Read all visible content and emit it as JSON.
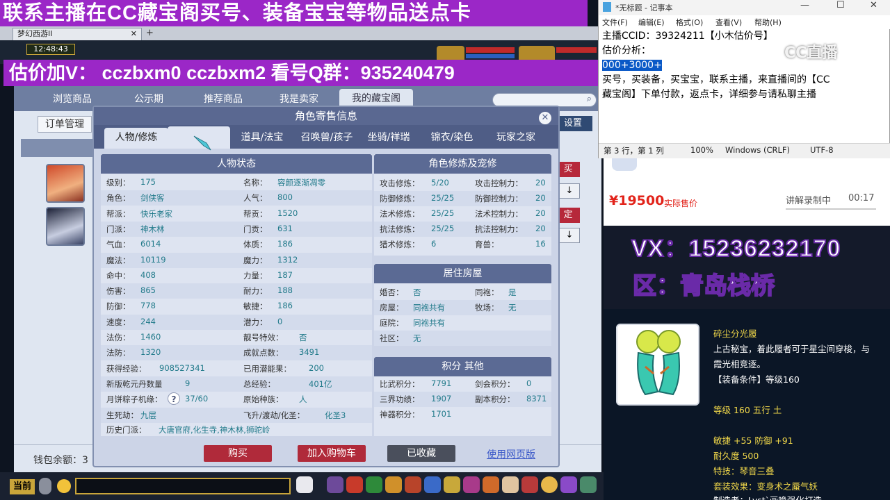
{
  "overlays": {
    "banner_top": "联系主播在CC藏宝阁买号、装备宝宝等物品送点卡",
    "banner_second": "估价加V：  cczbxm0   cczbxm2   看号Q群：935240479",
    "vx": "VX：15236232170",
    "region": "区：青岛栈桥",
    "cc_watermark": "CC直播"
  },
  "game": {
    "browser_tab": "梦幻西游II",
    "clock": "12:48:43",
    "nav": [
      "浏览商品",
      "公示期",
      "推荐商品",
      "我是卖家",
      "我的藏宝阁"
    ],
    "order_button": "订单管理",
    "settings_button": "设置",
    "list_buy": "买",
    "list_fixed": "定",
    "arrow": "↓",
    "wallet_label": "钱包余额：3",
    "current": "当前"
  },
  "dialog": {
    "title": "角色寄售信息",
    "close": "✕",
    "tabs": [
      "人物/修炼",
      "",
      "道具/法宝",
      "召唤兽/孩子",
      "坐骑/祥瑞",
      "锦衣/染色",
      "玩家之家"
    ],
    "char_status": {
      "title": "人物状态",
      "left": [
        {
          "label": "级别：",
          "value": "175"
        },
        {
          "label": "角色：",
          "value": "剑侠客"
        },
        {
          "label": "帮派：",
          "value": "快乐老家"
        },
        {
          "label": "门派：",
          "value": "神木林"
        },
        {
          "label": "气血：",
          "value": "6014"
        },
        {
          "label": "魔法：",
          "value": "10119"
        },
        {
          "label": "命中：",
          "value": "408"
        },
        {
          "label": "伤害：",
          "value": "865"
        },
        {
          "label": "防御：",
          "value": "778"
        },
        {
          "label": "速度：",
          "value": "244"
        },
        {
          "label": "法伤：",
          "value": "1460"
        },
        {
          "label": "法防：",
          "value": "1320"
        },
        {
          "label": "获得经验：",
          "value": "908527341"
        },
        {
          "label": "新版乾元丹数量",
          "value": "9"
        },
        {
          "label": "月饼粽子机缘：",
          "value": "37/60"
        },
        {
          "label": "生死劫：",
          "value": "九层"
        }
      ],
      "right": [
        {
          "label": "名称：",
          "value": "容颜逐渐凋零"
        },
        {
          "label": "人气：",
          "value": "800"
        },
        {
          "label": "帮贡：",
          "value": "1520"
        },
        {
          "label": "门贡：",
          "value": "631"
        },
        {
          "label": "体质：",
          "value": "186"
        },
        {
          "label": "魔力：",
          "value": "1312"
        },
        {
          "label": "力量：",
          "value": "187"
        },
        {
          "label": "耐力：",
          "value": "188"
        },
        {
          "label": "敏捷：",
          "value": "186"
        },
        {
          "label": "潜力：",
          "value": "0"
        },
        {
          "label": "靓号特效：",
          "value": "否"
        },
        {
          "label": "成就点数：",
          "value": "3491"
        },
        {
          "label": "已用潜能果：",
          "value": "200"
        },
        {
          "label": "总经验：",
          "value": "401亿"
        },
        {
          "label": "原始种族：",
          "value": "人"
        },
        {
          "label": "飞升/渡劫/化圣：",
          "value": "化圣3"
        }
      ],
      "history_label": "历史门派：",
      "history_value": "大唐官府,化生寺,神木林,狮驼岭"
    },
    "cultivation": {
      "title": "角色修炼及宠修",
      "rows": [
        {
          "l1": "攻击修炼：",
          "v1": "5/20",
          "l2": "攻击控制力：",
          "v2": "20"
        },
        {
          "l1": "防御修炼：",
          "v1": "25/25",
          "l2": "防御控制力：",
          "v2": "20"
        },
        {
          "l1": "法术修炼：",
          "v1": "25/25",
          "l2": "法术控制力：",
          "v2": "20"
        },
        {
          "l1": "抗法修炼：",
          "v1": "25/25",
          "l2": "抗法控制力：",
          "v2": "20"
        },
        {
          "l1": "猎术修炼：",
          "v1": "6",
          "l2": "育兽：",
          "v2": "16"
        }
      ]
    },
    "house": {
      "title": "居住房屋",
      "rows": [
        {
          "l1": "婚否：",
          "v1": "否",
          "l2": "同袍：",
          "v2": "是"
        },
        {
          "l1": "房屋：",
          "v1": "同袍共有",
          "l2": "牧场：",
          "v2": "无"
        },
        {
          "l1": "庭院：",
          "v1": "同袍共有",
          "l2": "",
          "v2": ""
        },
        {
          "l1": "社区：",
          "v1": "无",
          "l2": "",
          "v2": ""
        }
      ]
    },
    "points": {
      "title": "积分 其他",
      "rows": [
        {
          "l1": "比武积分：",
          "v1": "7791",
          "l2": "剑会积分：",
          "v2": "0"
        },
        {
          "l1": "三界功绩：",
          "v1": "1907",
          "l2": "副本积分：",
          "v2": "8371"
        },
        {
          "l1": "神器积分：",
          "v1": "1701",
          "l2": "",
          "v2": ""
        }
      ]
    },
    "buttons": {
      "buy": "购买",
      "cart": "加入购物车",
      "collected": "已收藏",
      "web": "使用网页版"
    },
    "question_mark": "?"
  },
  "notepad": {
    "title": "*无标题 - 记事本",
    "menu": [
      "文件(F)",
      "编辑(E)",
      "格式(O)",
      "查看(V)",
      "帮助(H)"
    ],
    "line1": "主播CCID：39324211【小木估价号】",
    "line2": "估价分析：",
    "line3": "000+3000+",
    "line4": "买号，买装备，买宝宝，联系主播，来直播间的【CC",
    "line5": "藏宝阁】下单付款，返点卡，详细参与请私聊主播",
    "status": {
      "pos": "第 3 行，第 1 列",
      "zoom": "100%",
      "eol": "Windows (CRLF)",
      "enc": "UTF-8"
    },
    "controls": {
      "min": "—",
      "max": "☐",
      "close": "✕"
    }
  },
  "listing": {
    "price": "¥19500",
    "price_label": "实际售价",
    "live": "讲解录制中",
    "live_time": "00:17"
  },
  "item": {
    "name": "碎尘分光履",
    "desc1": "上古秘宝，着此履者可于星尘间穿梭，与",
    "desc2": "霞光相竞逐。",
    "req": "【装备条件】等级160",
    "level": "等级 160  五行 土",
    "stats": "敏捷 +55  防御 +91",
    "durability": "耐久度  500",
    "special": "特技：琴音三叠",
    "set": "套装效果：变身术之蜃气妖",
    "maker": "制造者：Lyst`画唤强化打造"
  },
  "colors": {
    "accent_purple": "#9b27c7",
    "price_red": "#e2231a",
    "dialog_header": "#5b6a94",
    "value_teal": "#217a8a",
    "item_yellow": "#f1d84a"
  }
}
